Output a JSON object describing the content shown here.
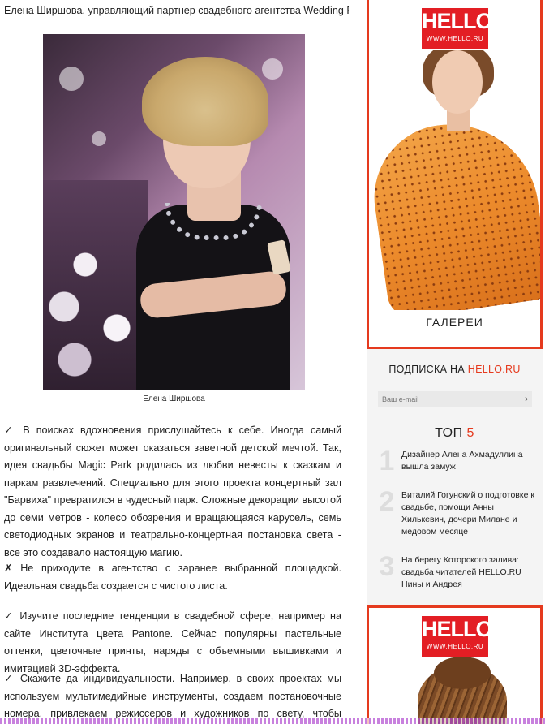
{
  "article": {
    "byline_prefix": "Елена Ширшова, управляющий партнер свадебного агентства ",
    "byline_link": "Wedding People",
    "photo_alt": "Елена Ширшова",
    "caption": "Елена Ширшова",
    "paragraphs": [
      "✓ В поисках вдохновения прислушайтесь к себе. Иногда самый оригинальный сюжет может оказаться заветной детской мечтой. Так, идея свадьбы Magic Park родилась из любви невесты к сказкам и паркам развлечений. Специально для этого проекта концертный зал \"Барвиха\" превратился в чудесный парк. Сложные декорации высотой до семи метров - колесо обозрения и вращающаяся карусель, семь светодиодных экранов и театрально-концертная постановка света - все это создавало настоящую магию.",
      "✗ Не приходите в агентство с заранее выбранной площадкой. Идеальная свадьба создается с чистого листа.",
      "✓ Изучите последние тенденции в свадебной сфере, например на сайте Института цвета Pantone. Сейчас популярны пастельные оттенки, цветочные принты, наряды с объемными вышивками и имитацией 3D-эффекта.",
      "✓ Скажите да индивидуальности. Например, в своих проектах мы используем мультимедийные инструменты, создаем постановочные номера, привлекаем режиссеров и художников по свету, чтобы создать незабываемое событие. А этот сезон мы стали..."
    ]
  },
  "sidebar": {
    "ad_top": {
      "logo_word": "HELLO!",
      "logo_url": "WWW.HELLO.RU",
      "label": "ГАЛЕРЕИ"
    },
    "subscribe": {
      "title_prefix": "ПОДПИСКА НА ",
      "title_accent": "HELLO.RU",
      "email_placeholder": "Ваш e-mail",
      "submit_glyph": "›"
    },
    "top5": {
      "label": "ТОП ",
      "number": "5",
      "items": [
        {
          "rank": "1",
          "title": "Дизайнер Алена Ахмадуллина вышла замуж"
        },
        {
          "rank": "2",
          "title": "Виталий Гогунский о подготовке к свадьбе, помощи Анны Хилькевич, дочери Милане и медовом месяце"
        },
        {
          "rank": "3",
          "title": "На берегу Которского залива: свадьба читателей HELLO.RU Нины и Андрея"
        }
      ]
    },
    "ad_bottom": {
      "logo_word": "HELLO!",
      "logo_url": "WWW.HELLO.RU"
    }
  },
  "colors": {
    "brand_red": "#e31e24",
    "accent": "#e53a1e"
  }
}
